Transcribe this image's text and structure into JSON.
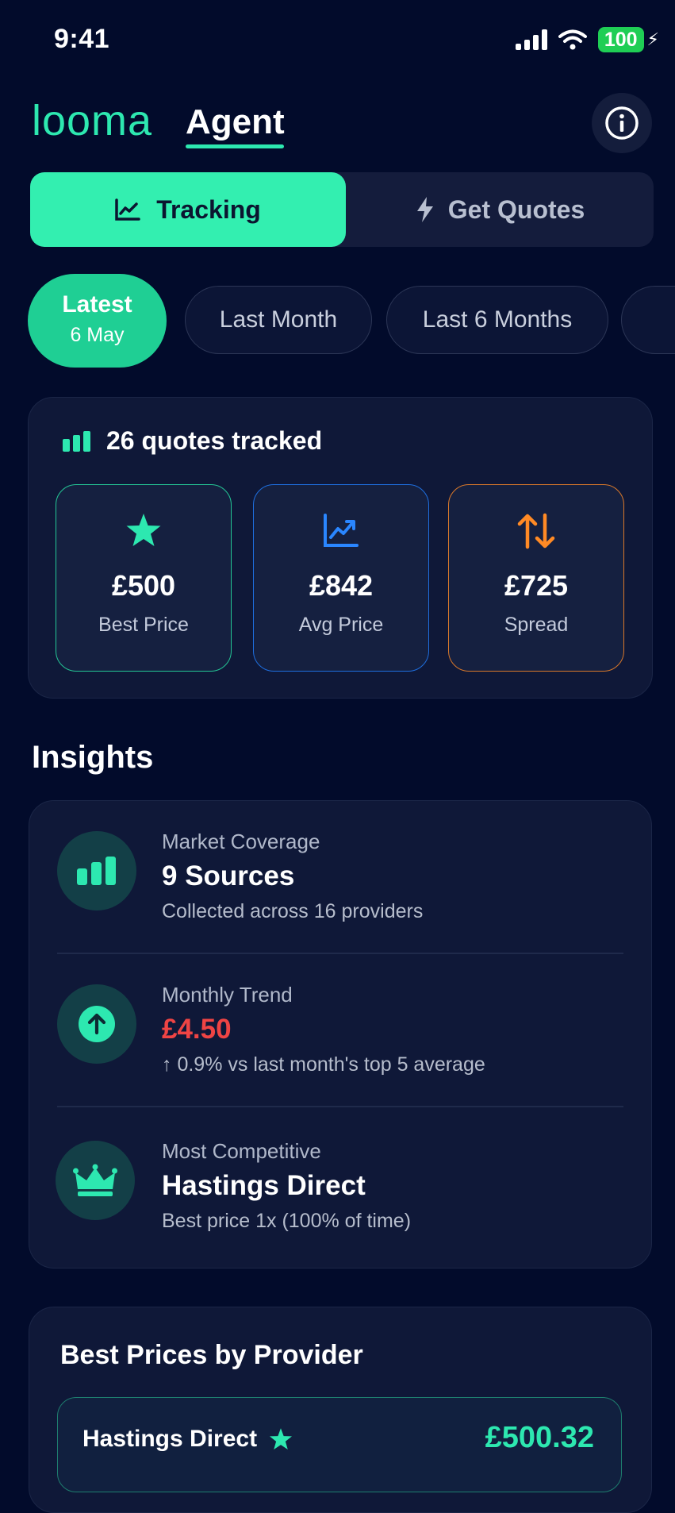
{
  "status_bar": {
    "time": "9:41",
    "battery": "100"
  },
  "header": {
    "logo": "looma",
    "title": "Agent"
  },
  "segments": {
    "tracking": "Tracking",
    "get_quotes": "Get Quotes"
  },
  "periods": {
    "latest_label": "Latest",
    "latest_date": "6 May",
    "last_month": "Last Month",
    "last_6_months": "Last 6 Months"
  },
  "stats": {
    "quotes_tracked": "26 quotes tracked",
    "best_price_value": "£500",
    "best_price_label": "Best Price",
    "avg_price_value": "£842",
    "avg_price_label": "Avg Price",
    "spread_value": "£725",
    "spread_label": "Spread"
  },
  "insights": {
    "title": "Insights",
    "items": [
      {
        "label": "Market Coverage",
        "value": "9 Sources",
        "sub": "Collected across 16 providers"
      },
      {
        "label": "Monthly Trend",
        "value": "£4.50",
        "sub": "↑ 0.9% vs last month's top 5 average"
      },
      {
        "label": "Most Competitive",
        "value": "Hastings Direct",
        "sub": "Best price 1x (100% of time)"
      }
    ]
  },
  "best_prices": {
    "title": "Best Prices by Provider",
    "rows": [
      {
        "provider": "Hastings Direct",
        "price": "£500.32"
      }
    ]
  },
  "colors": {
    "background": "#020b2b",
    "accent": "#2de8b0",
    "trend_red": "#ef4444",
    "avg_blue": "#1e6fe0",
    "spread_orange": "#d9782a"
  }
}
